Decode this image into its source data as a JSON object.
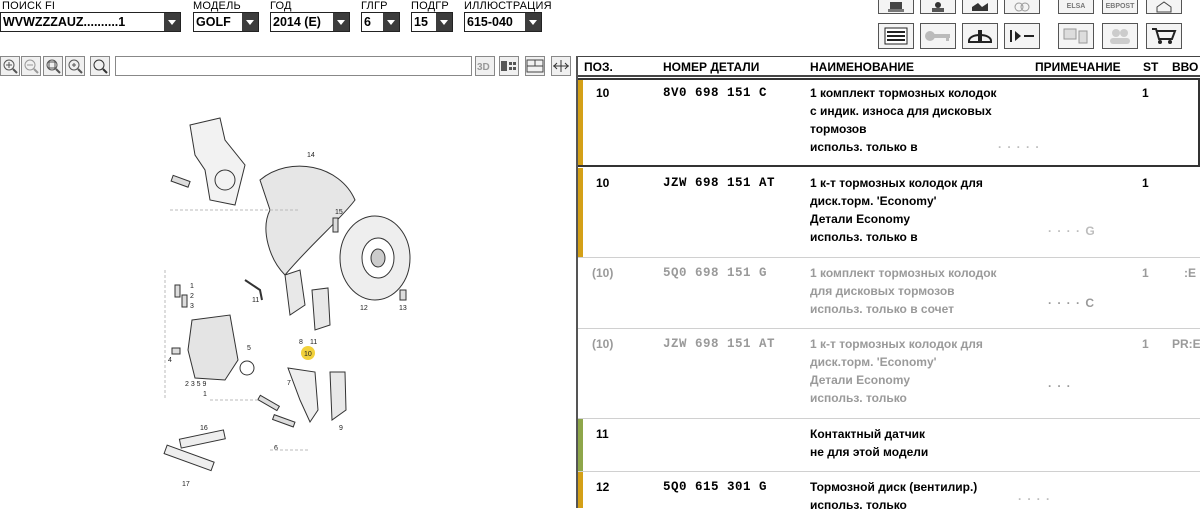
{
  "selectors": [
    {
      "label": "ПОИСК FI",
      "value": "WVWZZZAUZ..........1"
    },
    {
      "label": "МОДЕЛЬ",
      "value": "GOLF"
    },
    {
      "label": "ГОД",
      "value": "2014 (E)"
    },
    {
      "label": "ГЛГР",
      "value": "6"
    },
    {
      "label": "ПОДГР",
      "value": "15"
    },
    {
      "label": "ИЛЛЮСТРАЦИЯ",
      "value": "615-040"
    }
  ],
  "toolbar_right": {
    "elsa_label": "ELSA",
    "ebpost_label": "EBPOST"
  },
  "table": {
    "headers": {
      "pos": "ПОЗ.",
      "part": "НОМЕР ДЕТАЛИ",
      "name": "НАИМЕНОВАНИЕ",
      "note": "ПРИМЕЧАНИЕ",
      "st": "ST",
      "vvo": "ВВО"
    },
    "rows": [
      {
        "pos": "10",
        "part": "8V0 698 151 C",
        "lines": [
          "1 комплект тормозных колодок",
          "с индик. износа для дисковых",
          "тормозов",
          "использ. только в"
        ],
        "note_blur": "· · · · ·",
        "st": "1",
        "extra": "",
        "bar": "#d4a017"
      },
      {
        "pos": "10",
        "part": "JZW 698 151 AT",
        "lines": [
          "1 к-т тормозных колодок для",
          "диск.торм.           'Economy'",
          "Детали Economy",
          "использ. только в"
        ],
        "note_blur": "· ·  · · G",
        "st": "1",
        "extra": "",
        "bar": "#d4a017"
      },
      {
        "pos": "(10)",
        "part": "5Q0 698 151 G",
        "lines": [
          "1 комплект тормозных колодок",
          "для дисковых тормозов",
          "использ. только в сочет"
        ],
        "note_blur": "· · · · C",
        "st": "1",
        "extra": ":E",
        "bar": ""
      },
      {
        "pos": "(10)",
        "part": "JZW 698 151 AT",
        "lines": [
          "1 к-т тормозных колодок для",
          "диск.торм.           'Economy'",
          "Детали Economy",
          "использ. только"
        ],
        "note_blur": "· ·  ·",
        "st": "1",
        "extra": "PR:E",
        "bar": ""
      },
      {
        "pos": "11",
        "part": "",
        "lines": [
          "Контактный датчик",
          "не для этой модели"
        ],
        "note_blur": "",
        "st": "",
        "extra": "",
        "bar": "#8ea64a"
      },
      {
        "pos": "12",
        "part": "5Q0 615 301 G",
        "lines": [
          "Тормозной диск (вентилир.)",
          "использ. только"
        ],
        "note_blur": "· · · ·",
        "st": "",
        "extra": "",
        "bar": "#d4a017"
      }
    ]
  },
  "diagram": {
    "labels": [
      "14",
      "15",
      "12",
      "13",
      "1",
      "2",
      "3",
      "11",
      "8",
      "11",
      "10",
      "5",
      "4",
      "2 3 5 9",
      "1",
      "7",
      "6",
      "9",
      "16",
      "17"
    ]
  }
}
